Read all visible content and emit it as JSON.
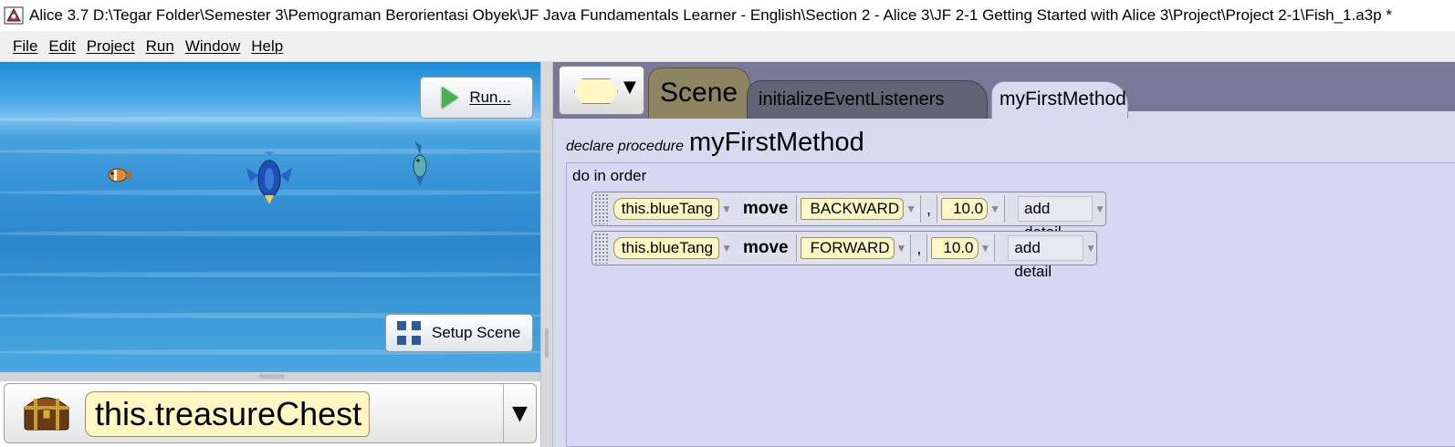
{
  "window": {
    "title": "Alice 3.7 D:\\Tegar Folder\\Semester 3\\Pemograman Berorientasi Obyek\\JF Java Fundamentals Learner - English\\Section 2 - Alice 3\\JF 2-1 Getting Started with Alice 3\\Project\\Project 2-1\\Fish_1.a3p *"
  },
  "menu": {
    "items": [
      {
        "label": "File"
      },
      {
        "label": "Edit"
      },
      {
        "label": "Project"
      },
      {
        "label": "Run"
      },
      {
        "label": "Window"
      },
      {
        "label": "Help"
      }
    ]
  },
  "scene_view": {
    "run_label": "Run...",
    "setup_label": "Setup Scene"
  },
  "object_selector": {
    "selected": "this.treasureChest"
  },
  "tabs": {
    "scene": "Scene",
    "initialize": "initializeEventListeners",
    "current": "myFirstMethod"
  },
  "method": {
    "declare_keyword": "declare procedure",
    "name": "myFirstMethod",
    "block_label": "do in order",
    "statements": [
      {
        "object": "this.blueTang",
        "verb": "move",
        "direction": "BACKWARD",
        "amount": "10.0",
        "detail": "add detail"
      },
      {
        "object": "this.blueTang",
        "verb": "move",
        "direction": "FORWARD",
        "amount": "10.0",
        "detail": "add detail"
      }
    ]
  },
  "colors": {
    "tab_strip": "#7a7898",
    "code_bg": "#d8daf0",
    "pill_fill": "#fff7c2",
    "scene_tab": "#8c8560"
  }
}
